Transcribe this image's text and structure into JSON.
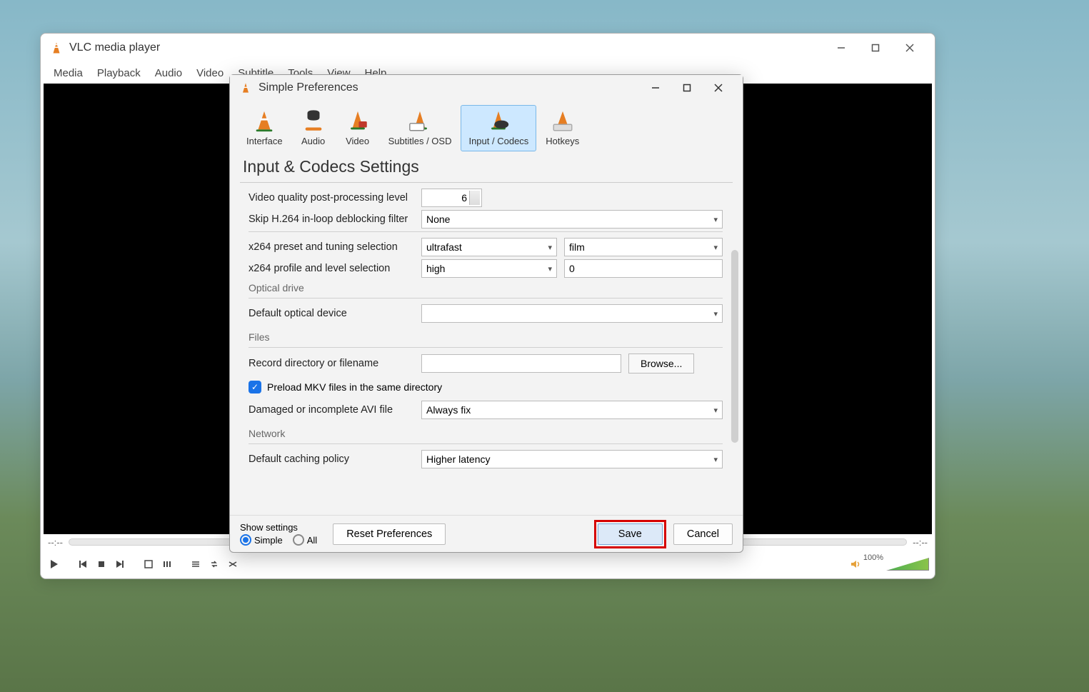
{
  "vlc": {
    "title": "VLC media player",
    "menus": [
      "Media",
      "Playback",
      "Audio",
      "Video",
      "Subtitle",
      "Tools",
      "View",
      "Help"
    ],
    "time_left": "--:--",
    "time_right": "--:--",
    "volume_label": "100%"
  },
  "prefs": {
    "title": "Simple Preferences",
    "tabs": [
      {
        "label": "Interface"
      },
      {
        "label": "Audio"
      },
      {
        "label": "Video"
      },
      {
        "label": "Subtitles / OSD"
      },
      {
        "label": "Input / Codecs",
        "active": true
      },
      {
        "label": "Hotkeys"
      }
    ],
    "heading": "Input & Codecs Settings",
    "rows": {
      "pp_label": "Video quality post-processing level",
      "pp_value": "6",
      "deblock_label": "Skip H.264 in-loop deblocking filter",
      "deblock_value": "None",
      "x264preset_label": "x264 preset and tuning selection",
      "x264preset_value": "ultrafast",
      "x264tuning_value": "film",
      "x264profile_label": "x264 profile and level selection",
      "x264profile_value": "high",
      "x264level_value": "0"
    },
    "optical": {
      "title": "Optical drive",
      "label": "Default optical device",
      "value": ""
    },
    "files": {
      "title": "Files",
      "record_label": "Record directory or filename",
      "record_value": "",
      "browse": "Browse...",
      "preload_label": "Preload MKV files in the same directory",
      "preload_checked": true,
      "avi_label": "Damaged or incomplete AVI file",
      "avi_value": "Always fix"
    },
    "network": {
      "title": "Network",
      "cache_label": "Default caching policy",
      "cache_value": "Higher latency"
    },
    "footer": {
      "show_settings": "Show settings",
      "simple": "Simple",
      "all": "All",
      "reset": "Reset Preferences",
      "save": "Save",
      "cancel": "Cancel"
    }
  }
}
